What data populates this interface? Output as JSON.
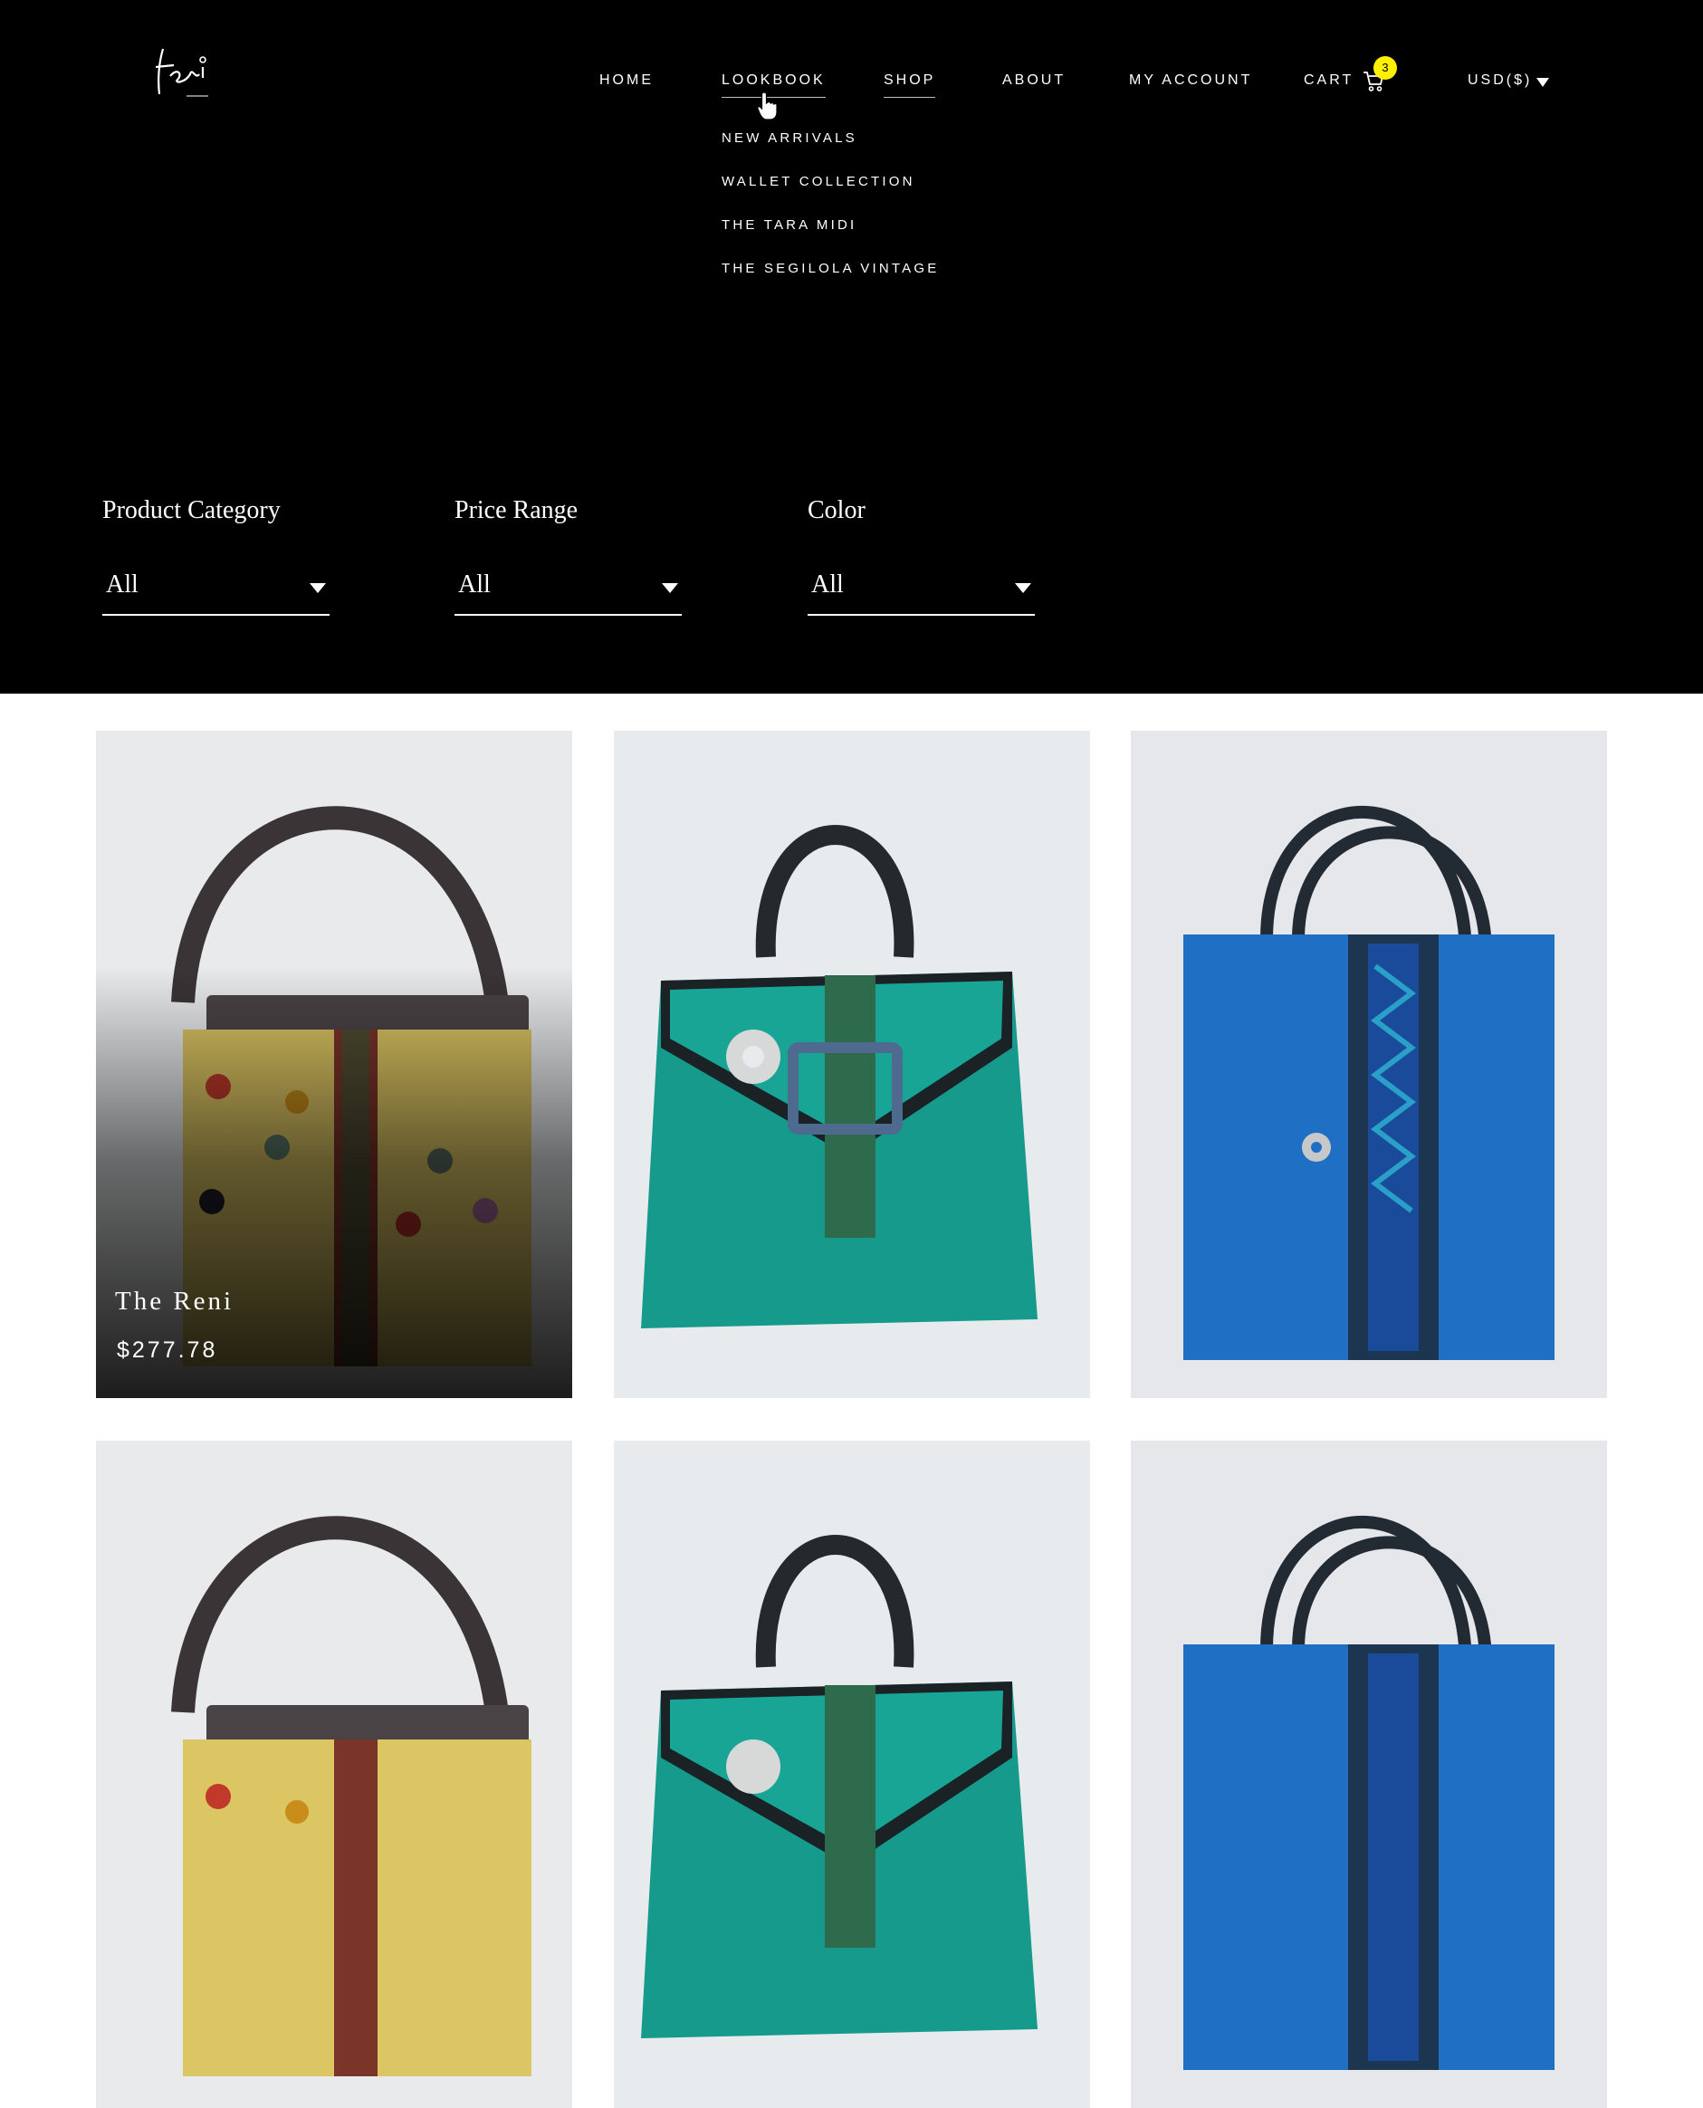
{
  "brand": {
    "logo_alt": "feni"
  },
  "nav": {
    "home": "HOME",
    "lookbook": "LOOKBOOK",
    "shop": "SHOP",
    "about": "ABOUT",
    "account": "MY ACCOUNT",
    "cart": "CART",
    "cart_count": "3",
    "currency": "USD($)"
  },
  "lookbook_menu": [
    "NEW ARRIVALS",
    "WALLET COLLECTION",
    "THE TARA MIDI",
    "THE SEGILOLA VINTAGE"
  ],
  "filters": {
    "category": {
      "label": "Product Category",
      "value": "All"
    },
    "price": {
      "label": "Price Range",
      "value": "All"
    },
    "color": {
      "label": "Color",
      "value": "All"
    }
  },
  "products": [
    {
      "title": "The Reni",
      "price": "$277.78"
    }
  ],
  "colors": {
    "header_bg": "#000000",
    "badge": "#ffef00",
    "yellow_bag": "#e0c66a",
    "teal_bag": "#13988b",
    "blue_bag": "#1f6fc4"
  }
}
